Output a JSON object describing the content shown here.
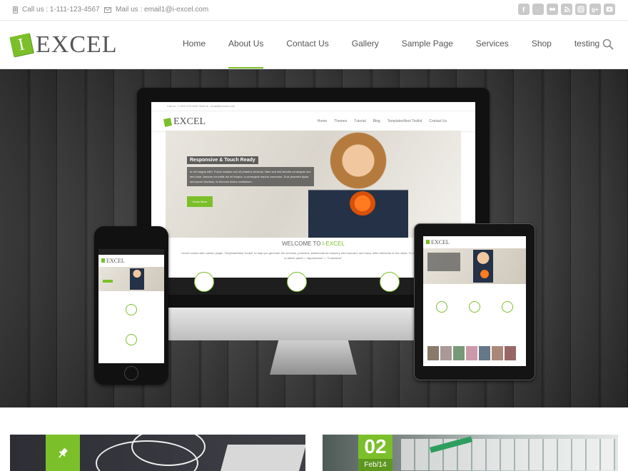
{
  "topbar": {
    "phone": "Call us : 1-111-123-4567",
    "email": "Mail us : email1@i-excel.com",
    "social_icons": [
      "facebook-icon",
      "twitter-icon",
      "flickr-icon",
      "rss-icon",
      "instagram-icon",
      "google-plus-icon",
      "youtube-icon"
    ]
  },
  "logo": {
    "mark": "I",
    "text": "EXCEL"
  },
  "nav": {
    "items": [
      "Home",
      "About Us",
      "Contact Us",
      "Gallery",
      "Sample Page",
      "Services",
      "Shop",
      "testing"
    ],
    "active": "About Us"
  },
  "mockup": {
    "topbar_text": "Call us : 1-000-123-4567     Mail us : email@i-excel.com",
    "logo_text": "EXCEL",
    "nav": [
      "Home",
      "Themes",
      "Tutorial",
      "Blog",
      "TemplatesNext Toolkit",
      "Contact Us"
    ],
    "slide_title": "Responsive & Touch Ready",
    "slide_text": "In vel magna nibh. Fusce sodales orci sit phaetra vehicula. Nam sed nisi lobortis consequat non sed dolor. Aenean convallis dui mi tempor, a consequat mauris commodo. Duis pharetra ligula sed ipsum faucibus, id rhoncus lectus vestibulum.",
    "slide_button": "Know More",
    "welcome_prefix": "WELCOME TO ",
    "welcome_brand": "I-EXCEL",
    "welcome_text": "i-excel comes with custom plugin \"TemplatesNext Toolkit\" to help you generate the services, portfolios, testimonial as masonry and carousel, and many other elements in few clicks. To start Setting up i-excel, go to admin panel > \"Appearance\" > \"Customize\""
  },
  "cards": {
    "date_day": "02",
    "date_month": "Feb/14"
  },
  "colors": {
    "accent": "#7bbf2a",
    "text": "#666666"
  }
}
